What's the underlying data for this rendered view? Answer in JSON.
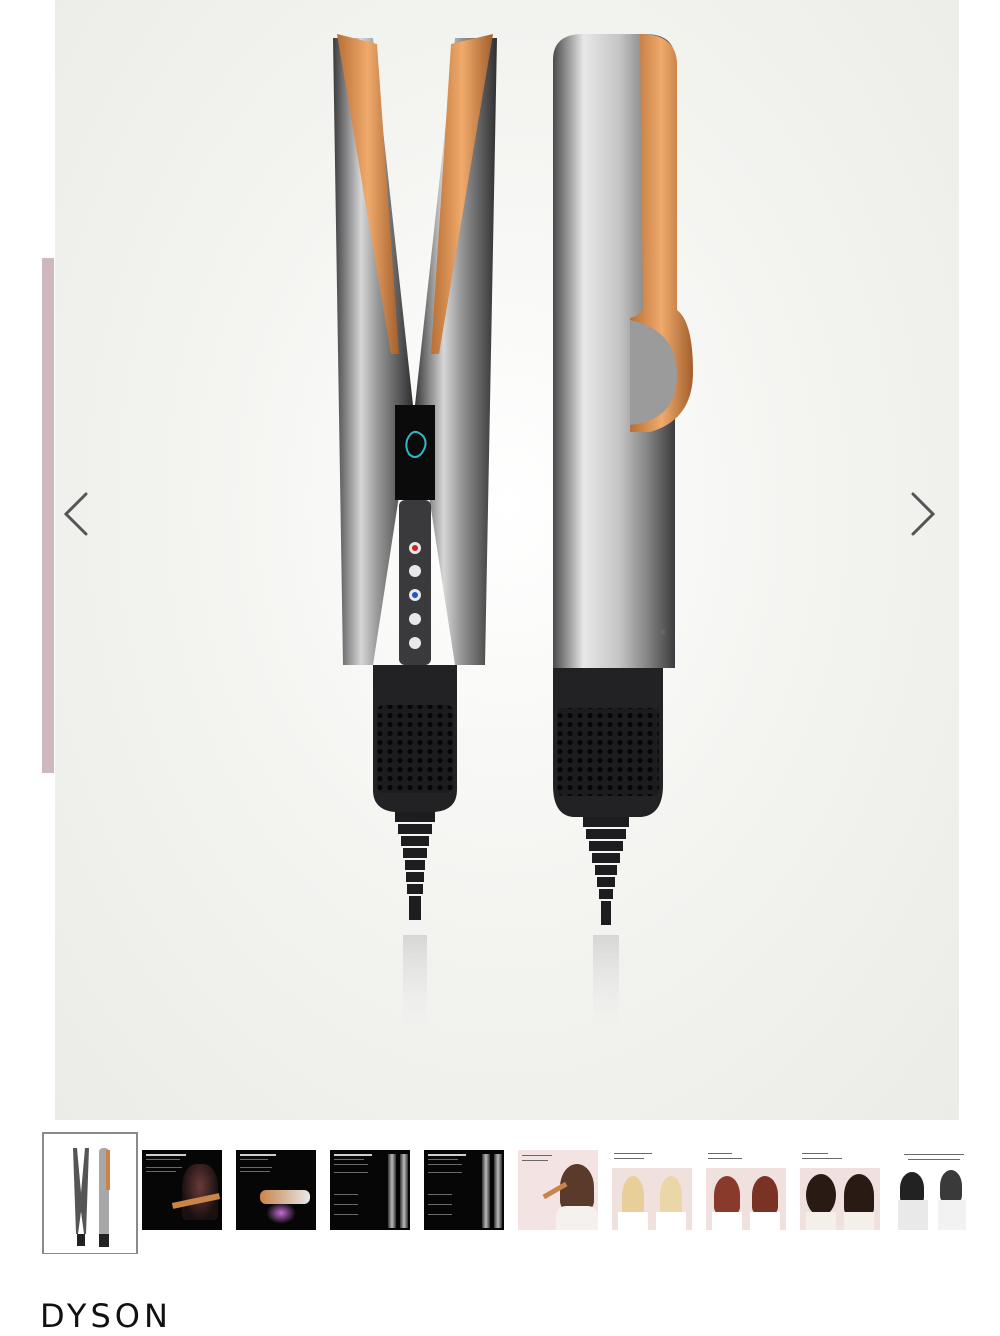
{
  "brand": "DYSON",
  "gallery": {
    "current_index": 1,
    "total_images": 10,
    "thumbnails": [
      {
        "name": "product-front"
      },
      {
        "name": "wet-to-dry-straightening"
      },
      {
        "name": "directional-airflow"
      },
      {
        "name": "straighten-from-wet-controls"
      },
      {
        "name": "straighten-from-dry-controls"
      },
      {
        "name": "styling-back-view"
      },
      {
        "name": "before-after-straight"
      },
      {
        "name": "before-after-wavy"
      },
      {
        "name": "before-after-curly"
      },
      {
        "name": "models-straightening"
      }
    ]
  },
  "colors": {
    "accent_copper": "#c98449",
    "scrollbar": "#cfb8bd",
    "thumb_border": "#8a8a8a"
  },
  "icons": {
    "prev": "chevron-left-icon",
    "next": "chevron-right-icon"
  }
}
